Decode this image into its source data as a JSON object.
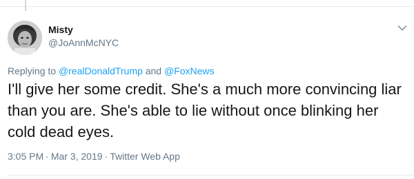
{
  "author": {
    "name": "Misty",
    "handle": "@JoAnnMcNYC"
  },
  "reply_context": {
    "prefix": "Replying to",
    "mention_1": "@realDonaldTrump",
    "conjunction": "and",
    "mention_2": "@FoxNews"
  },
  "tweet": {
    "text": "I'll give her some credit. She's a much more convincing liar than you are. She's able to lie without once blinking her cold dead eyes."
  },
  "meta": {
    "time": "3:05 PM",
    "separator": "·",
    "date": "Mar 3, 2019",
    "source": "Twitter Web App"
  },
  "icons": {
    "menu": "chevron-down-icon"
  },
  "colors": {
    "text": "#14171a",
    "secondary": "#657786",
    "link": "#1da1f2",
    "border": "#e6ecf0"
  }
}
